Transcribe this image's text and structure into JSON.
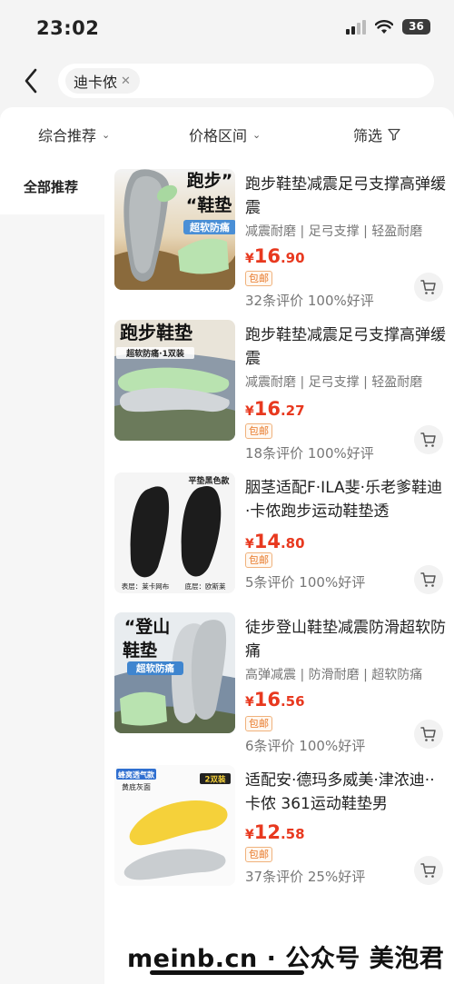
{
  "status_bar": {
    "time": "23:02",
    "battery": "36"
  },
  "search": {
    "query": "迪卡侬"
  },
  "filters": [
    {
      "label": "综合推荐"
    },
    {
      "label": "价格区间"
    },
    {
      "label": "筛选"
    }
  ],
  "sidebar": {
    "items": [
      {
        "label": "全部推荐"
      }
    ]
  },
  "products": [
    {
      "title": "跑步鞋垫减震足弓支撑高弹缓震",
      "tags": "减震耐磨 | 足弓支撑 | 轻盈耐磨",
      "price_int": "16",
      "price_dec": ".90",
      "badge": "包邮",
      "reviews": "32条评价  100%好评",
      "image_text": [
        "跑步”",
        "“鞋垫",
        "超软防痛"
      ]
    },
    {
      "title": "跑步鞋垫减震足弓支撑高弹缓震",
      "tags": "减震耐磨 | 足弓支撑 | 轻盈耐磨",
      "price_int": "16",
      "price_dec": ".27",
      "badge": "包邮",
      "reviews": "18条评价  100%好评",
      "image_text": [
        "跑步鞋垫",
        "超软防痛·1双装"
      ]
    },
    {
      "title": "胭茎适配F·ILA斐·乐老爹鞋迪·卡侬跑步运动鞋垫透",
      "tags": "",
      "price_int": "14",
      "price_dec": ".80",
      "badge": "包邮",
      "reviews": "5条评价  100%好评",
      "image_text": [
        "平垫黑色款",
        "表层：莱卡网布",
        "底层：欧斯莱"
      ]
    },
    {
      "title": "徒步登山鞋垫减震防滑超软防痛",
      "tags": "高弹减震 | 防滑耐磨 | 超软防痛",
      "price_int": "16",
      "price_dec": ".56",
      "badge": "包邮",
      "reviews": "6条评价  100%好评",
      "image_text": [
        "“登山",
        "鞋垫",
        "超软防痛"
      ]
    },
    {
      "title": "适配安·德玛多威美·津浓迪··卡侬 361运动鞋垫男",
      "tags": "",
      "price_int": "12",
      "price_dec": ".58",
      "badge": "包邮",
      "reviews": "37条评价  25%好评",
      "image_text": [
        "蜂窝透气款",
        "黄底灰面",
        "2双装"
      ]
    }
  ],
  "currency": "¥",
  "watermark": "meinb.cn · 公众号 美泡君",
  "colors": {
    "price": "#e8391f",
    "badge": "#e87b2c",
    "insole_green": "#b9e3b0"
  }
}
